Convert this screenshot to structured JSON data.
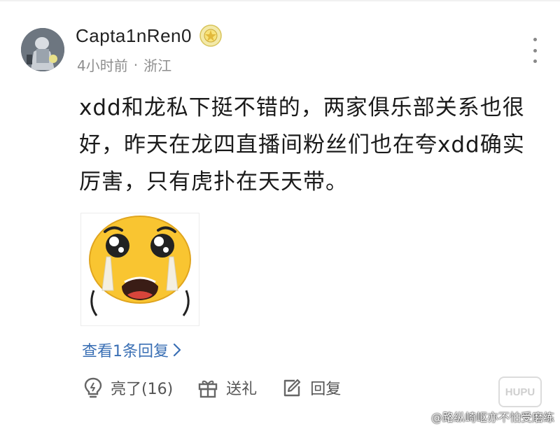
{
  "comment": {
    "author": "Capta1nRen0",
    "time": "4小时前",
    "separator": "·",
    "location": "浙江",
    "text": "xdd和龙私下挺不错的，两家俱乐部关系也很好，昨天在龙四直播间粉丝们也在夸xdd确实厉害，只有虎扑在天天带。",
    "sticker_icon": "crying-emoji-sticker",
    "view_replies": "查看1条回复"
  },
  "actions": {
    "like_label": "亮了(16)",
    "gift_label": "送礼",
    "reply_label": "回复"
  },
  "watermark": {
    "text": "@路纵崎岖亦不怕受磨练",
    "logo": "HUPU"
  },
  "colors": {
    "link": "#3a6fb4",
    "muted": "#8e8e8e",
    "sticker_face": "#f9c531"
  }
}
